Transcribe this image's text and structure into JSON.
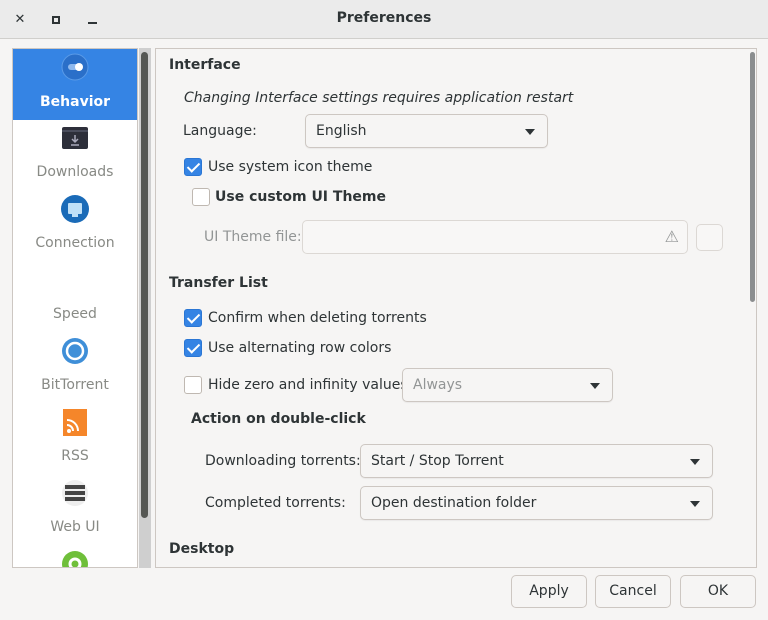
{
  "window": {
    "title": "Preferences",
    "close": "✕",
    "maximize": "□",
    "minimize": "—"
  },
  "sidebar": {
    "items": [
      {
        "label": "Behavior",
        "icon": "toggle-icon",
        "selected": true
      },
      {
        "label": "Downloads",
        "icon": "download-folder-icon"
      },
      {
        "label": "Connection",
        "icon": "network-icon"
      },
      {
        "label": "Speed",
        "icon": "speed-icon"
      },
      {
        "label": "BitTorrent",
        "icon": "globe-icon"
      },
      {
        "label": "RSS",
        "icon": "rss-icon"
      },
      {
        "label": "Web UI",
        "icon": "server-icon"
      },
      {
        "label": "",
        "icon": "gear-icon"
      }
    ]
  },
  "interface": {
    "title": "Interface",
    "note": "Changing Interface settings requires application restart",
    "language_label": "Language:",
    "language_value": "English",
    "system_icon_theme": "Use system icon theme",
    "system_icon_theme_checked": true,
    "custom_ui_theme": "Use custom UI Theme",
    "custom_ui_theme_checked": false,
    "theme_file_label": "UI Theme file:",
    "theme_file_value": ""
  },
  "transfer": {
    "title": "Transfer List",
    "confirm_delete": "Confirm when deleting torrents",
    "confirm_delete_checked": true,
    "alt_rows": "Use alternating row colors",
    "alt_rows_checked": true,
    "hide_zero": "Hide zero and infinity values",
    "hide_zero_checked": false,
    "hide_zero_value": "Always",
    "dbl_title": "Action on double-click",
    "downloading_label": "Downloading torrents:",
    "downloading_value": "Start / Stop Torrent",
    "completed_label": "Completed torrents:",
    "completed_value": "Open destination folder"
  },
  "desktop": {
    "title": "Desktop"
  },
  "buttons": {
    "apply": "Apply",
    "cancel": "Cancel",
    "ok": "OK"
  },
  "colors": {
    "accent": "#3584e4"
  }
}
